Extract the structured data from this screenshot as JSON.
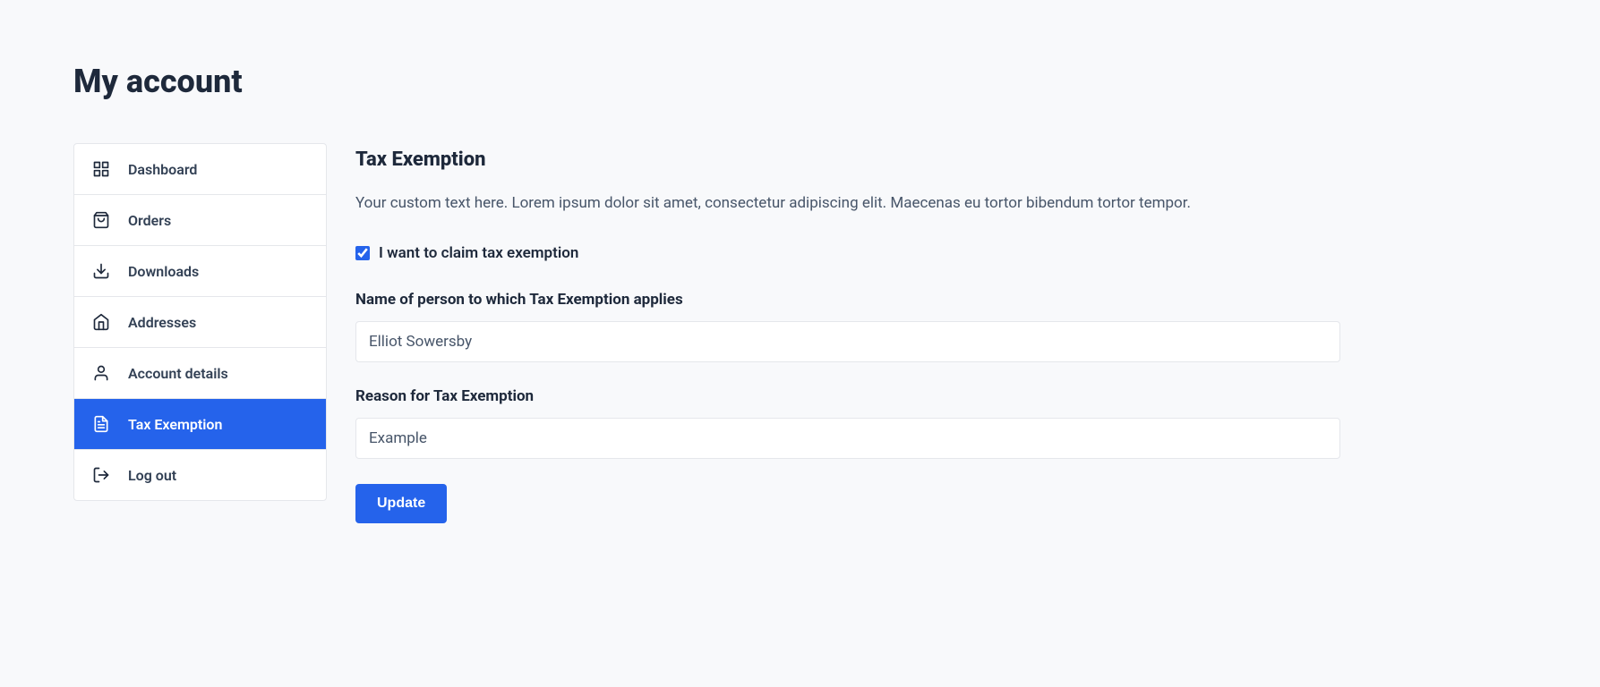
{
  "page": {
    "title": "My account"
  },
  "sidebar": {
    "items": [
      {
        "label": "Dashboard"
      },
      {
        "label": "Orders"
      },
      {
        "label": "Downloads"
      },
      {
        "label": "Addresses"
      },
      {
        "label": "Account details"
      },
      {
        "label": "Tax Exemption"
      },
      {
        "label": "Log out"
      }
    ]
  },
  "main": {
    "title": "Tax Exemption",
    "description": "Your custom text here. Lorem ipsum dolor sit amet, consectetur adipiscing elit. Maecenas eu tortor bibendum tortor tempor.",
    "claim_checkbox_label": "I want to claim tax exemption",
    "claim_checkbox_checked": true,
    "name_label": "Name of person to which Tax Exemption applies",
    "name_value": "Elliot Sowersby",
    "reason_label": "Reason for Tax Exemption",
    "reason_value": "Example",
    "update_button_label": "Update"
  }
}
